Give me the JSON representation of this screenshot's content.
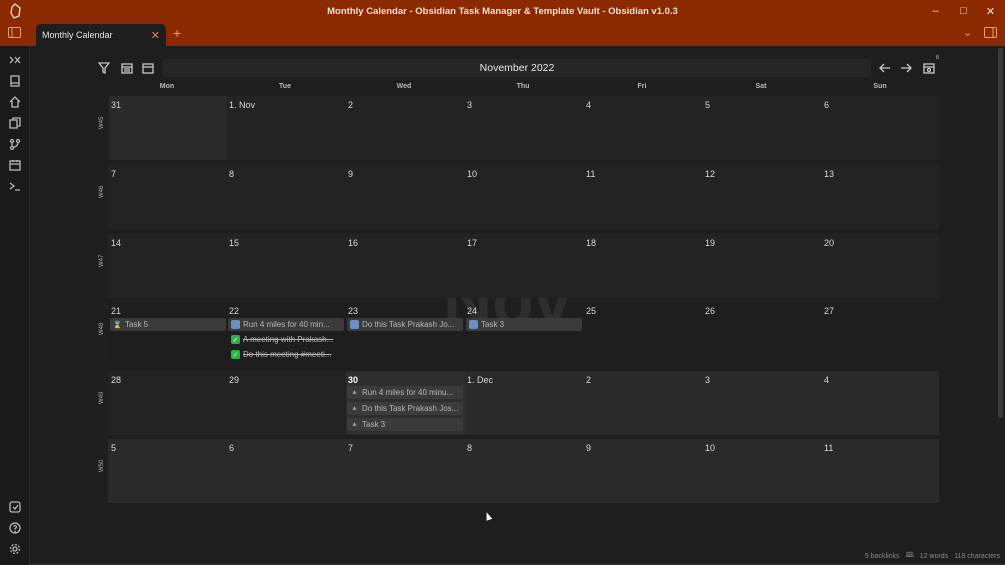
{
  "window": {
    "title": "Monthly Calendar - Obsidian Task Manager & Template Vault - Obsidian v1.0.3"
  },
  "tabs": [
    {
      "label": "Monthly Calendar"
    }
  ],
  "calendar": {
    "month": "November 2022",
    "badge": "8",
    "watermark": "Nov",
    "days": [
      "Mon",
      "Tue",
      "Wed",
      "Thu",
      "Fri",
      "Sat",
      "Sun"
    ],
    "weeks": [
      {
        "label": "W45",
        "dates": [
          "31",
          "1. Nov",
          "2",
          "3",
          "4",
          "5",
          "6"
        ]
      },
      {
        "label": "W46",
        "dates": [
          "7",
          "8",
          "9",
          "10",
          "11",
          "12",
          "13"
        ]
      },
      {
        "label": "W47",
        "dates": [
          "14",
          "15",
          "16",
          "17",
          "18",
          "19",
          "20"
        ]
      },
      {
        "label": "W48",
        "dates": [
          "21",
          "22",
          "23",
          "24",
          "25",
          "26",
          "27"
        ]
      },
      {
        "label": "W49",
        "dates": [
          "28",
          "29",
          "30",
          "1. Dec",
          "2",
          "3",
          "4"
        ]
      },
      {
        "label": "W50",
        "dates": [
          "5",
          "6",
          "7",
          "8",
          "9",
          "10",
          "11"
        ]
      }
    ],
    "tasks": {
      "w48_mon": "Task 5",
      "w48_tue_1": "Run 4 miles for 40 min...",
      "w48_tue_2": "A meeting with Prakash...",
      "w48_tue_3": "Do this meeting #meeti...",
      "w48_wed": "Do this Task Prakash Jo...",
      "w48_thu": "Task 3",
      "w49_wed_1": "Run 4 miles for 40 minu...",
      "w49_wed_2": "Do this Task Prakash Jos...",
      "w49_wed_3": "Task 3"
    }
  },
  "status": {
    "backlinks": "5 backlinks",
    "words": "12 words",
    "chars": "118 characters"
  },
  "colors": {
    "accent": "#8b2a00",
    "background": "#1e1e1e"
  }
}
